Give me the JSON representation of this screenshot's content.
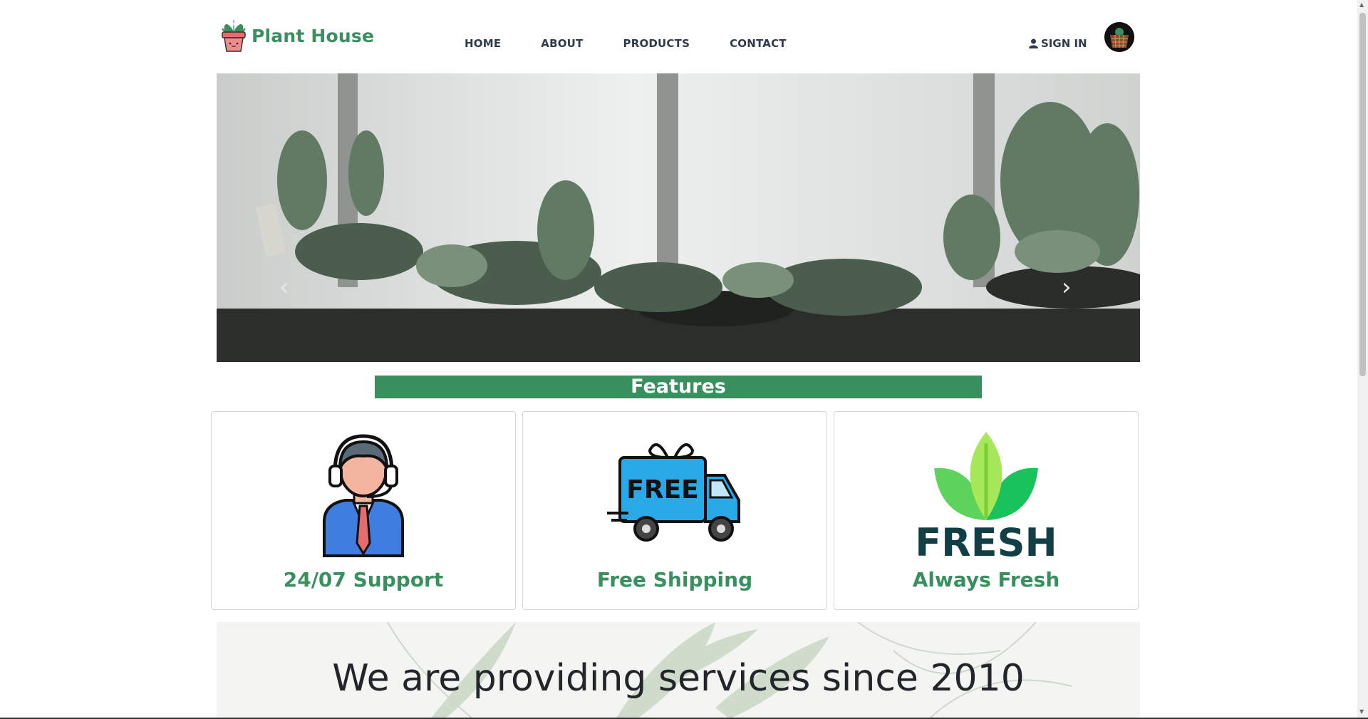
{
  "brand": {
    "name": "Plant House",
    "accent": "#3a8f5f"
  },
  "nav": {
    "items": [
      {
        "label": "HOME"
      },
      {
        "label": "ABOUT"
      },
      {
        "label": "PRODUCTS"
      },
      {
        "label": "CONTACT"
      }
    ]
  },
  "auth": {
    "signin_label": "SIGN IN",
    "icon": "user-icon"
  },
  "cart": {
    "icon": "basket-icon"
  },
  "hero": {
    "alt": "succulent plants on a windowsill",
    "prev_icon": "chevron-left-icon",
    "next_icon": "chevron-right-icon"
  },
  "features": {
    "title": "Features",
    "cards": [
      {
        "label": "24/07 Support",
        "icon": "support-agent-icon"
      },
      {
        "label": "Free Shipping",
        "icon": "delivery-truck-icon",
        "badge": "FREE"
      },
      {
        "label": "Always Fresh",
        "icon": "fresh-leaf-icon",
        "badge": "FRESH"
      }
    ]
  },
  "services": {
    "heading": "We are providing services since 2010"
  }
}
